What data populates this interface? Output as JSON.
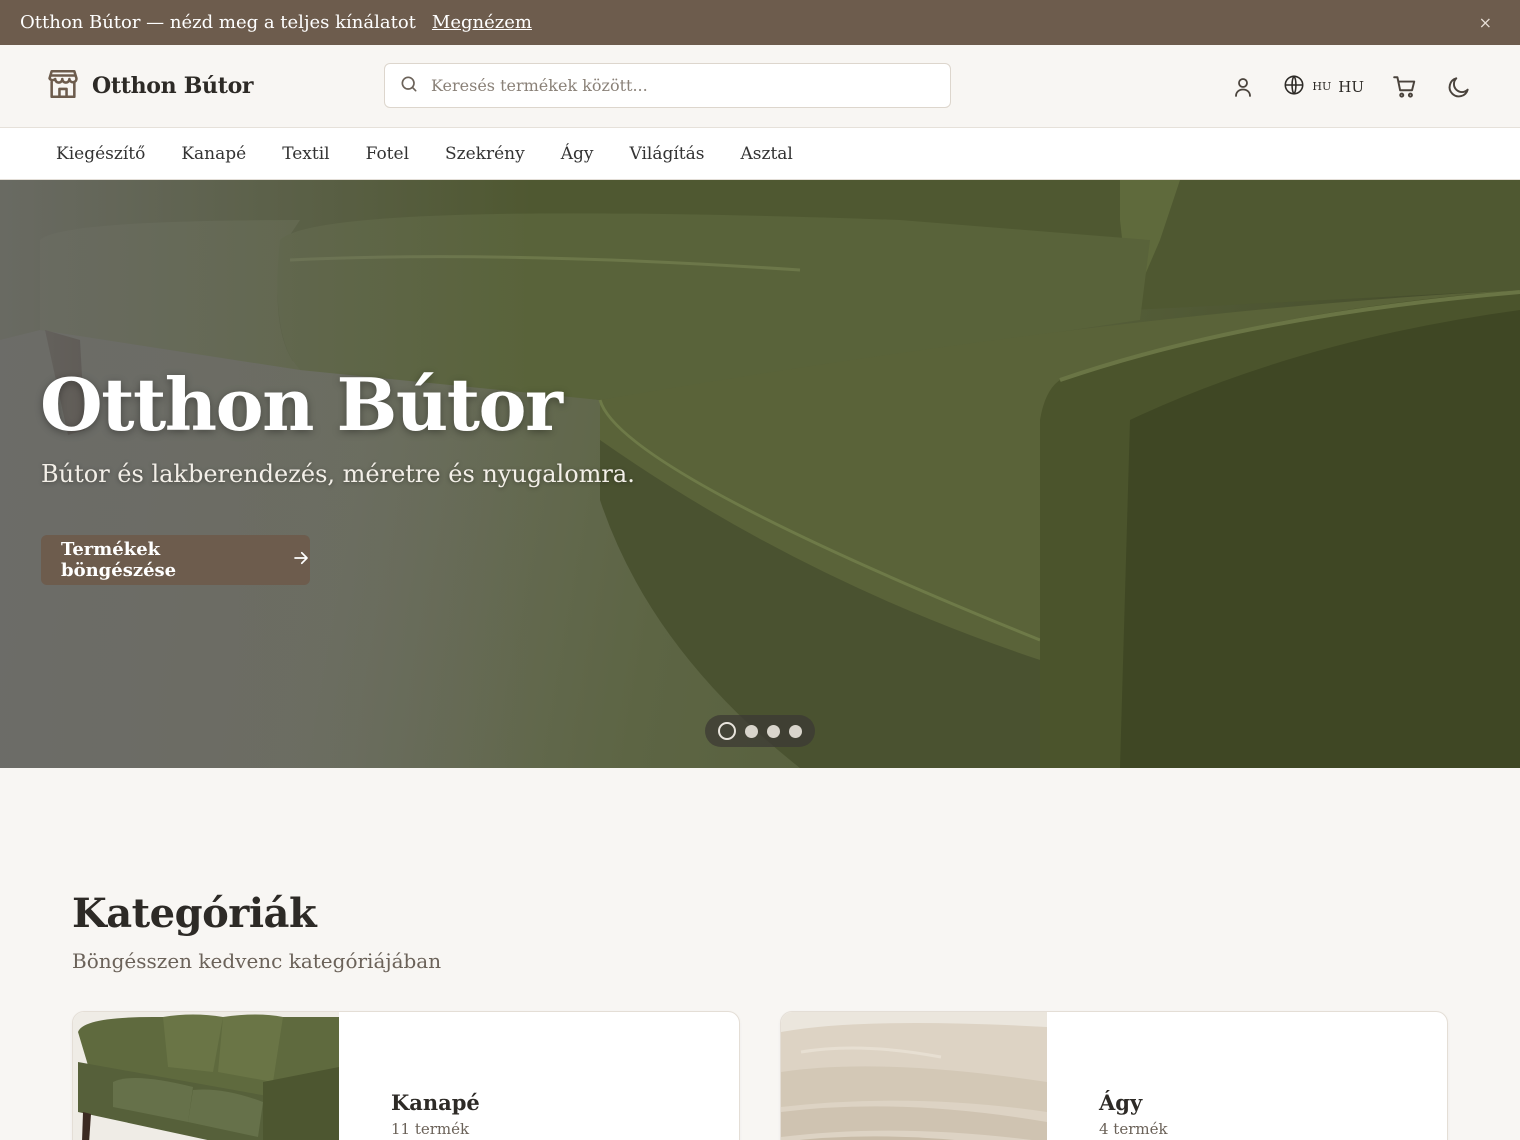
{
  "announcement": {
    "text": "Otthon Bútor — nézd meg a teljes kínálatot",
    "link": "Megnézem",
    "close": "×"
  },
  "header": {
    "brand": "Otthon Bútor",
    "search_placeholder": "Keresés termékek között...",
    "lang_small": "HU",
    "lang_big": "HU"
  },
  "nav": {
    "items": [
      {
        "label": "Kiegészítő"
      },
      {
        "label": "Kanapé"
      },
      {
        "label": "Textil"
      },
      {
        "label": "Fotel"
      },
      {
        "label": "Szekrény"
      },
      {
        "label": "Ágy"
      },
      {
        "label": "Világítás"
      },
      {
        "label": "Asztal"
      }
    ]
  },
  "hero": {
    "title": "Otthon Bútor",
    "subtitle": "Bútor és lakberendezés, méretre és nyugalomra.",
    "cta": "Termékek böngészése",
    "slides": 4,
    "active_slide": 1
  },
  "categories": {
    "title": "Kategóriák",
    "subtitle": "Böngésszen kedvenc kategóriájában",
    "items": [
      {
        "name": "Kanapé",
        "count": "11 termék"
      },
      {
        "name": "Ágy",
        "count": "4 termék"
      }
    ]
  },
  "colors": {
    "brand": "#6d5c4d",
    "sofa": "#5a6338",
    "background": "#f8f6f3"
  },
  "icons": [
    "store-icon",
    "search-icon",
    "user-icon",
    "globe-icon",
    "cart-icon",
    "moon-icon",
    "arrow-right-icon",
    "close-icon"
  ]
}
